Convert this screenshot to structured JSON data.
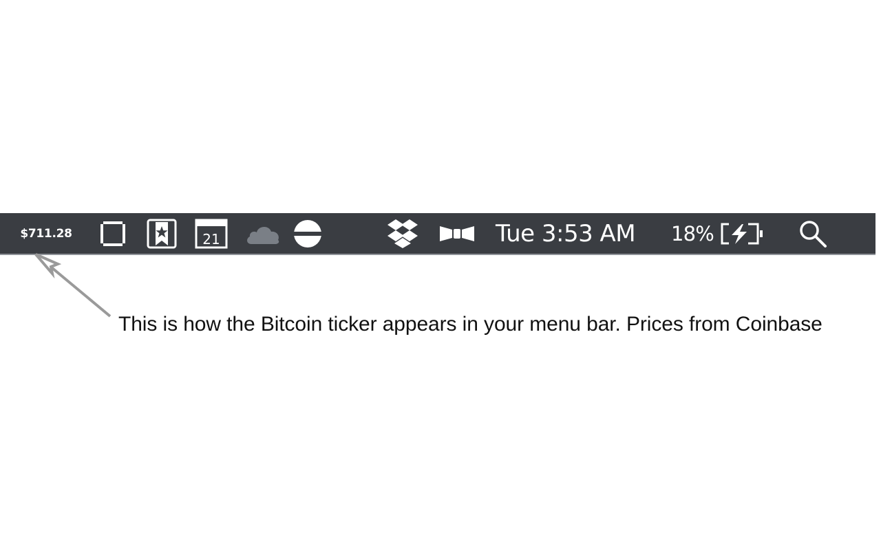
{
  "menubar": {
    "bitcoin_price": "$711.28",
    "calendar_day": "21",
    "clock": "Tue 3:53 AM",
    "battery_percent": "18%",
    "icons": [
      "square-outline-icon",
      "bookmark-star-icon",
      "calendar-icon",
      "cloud-icon",
      "circle-line-icon",
      "dropbox-icon",
      "bowtie-icon",
      "battery-charging-icon",
      "search-icon"
    ]
  },
  "annotation": {
    "text": "This is how the Bitcoin ticker appears in your menu bar. Prices from Coinbase"
  },
  "colors": {
    "menubar_bg": "#3a3d42",
    "menubar_text": "#ffffff",
    "cloud_icon": "#7a7f86",
    "arrow": "#9a9a9a"
  }
}
